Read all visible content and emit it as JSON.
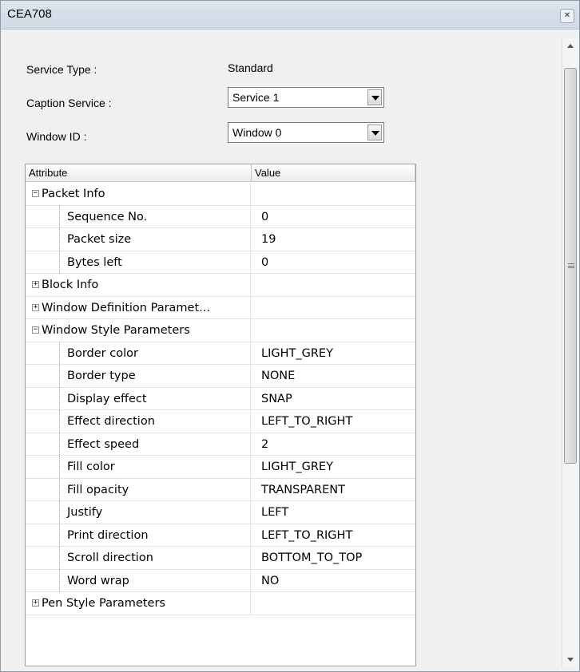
{
  "window": {
    "title": "CEA708",
    "close_icon": "close-icon"
  },
  "form": {
    "service_type_label": "Service Type :",
    "service_type_value": "Standard",
    "caption_service_label": "Caption Service :",
    "caption_service_value": "Service 1",
    "window_id_label": "Window ID :",
    "window_id_value": "Window 0"
  },
  "grid": {
    "headers": {
      "attribute": "Attribute",
      "value": "Value"
    },
    "rows": [
      {
        "label": "Packet Info",
        "value": "",
        "toggle": "−"
      },
      {
        "label": "Sequence No.",
        "value": "0"
      },
      {
        "label": "Packet size",
        "value": "19"
      },
      {
        "label": "Bytes left",
        "value": "0"
      },
      {
        "label": "Block Info",
        "value": "",
        "toggle": "+"
      },
      {
        "label": "Window Definition Paramet...",
        "value": "",
        "toggle": "+"
      },
      {
        "label": "Window Style Parameters",
        "value": "",
        "toggle": "−"
      },
      {
        "label": "Border color",
        "value": "LIGHT_GREY"
      },
      {
        "label": "Border type",
        "value": "NONE"
      },
      {
        "label": "Display effect",
        "value": "SNAP"
      },
      {
        "label": "Effect direction",
        "value": "LEFT_TO_RIGHT"
      },
      {
        "label": "Effect speed",
        "value": "2"
      },
      {
        "label": "Fill color",
        "value": "LIGHT_GREY"
      },
      {
        "label": "Fill opacity",
        "value": "TRANSPARENT"
      },
      {
        "label": "Justify",
        "value": "LEFT"
      },
      {
        "label": "Print direction",
        "value": "LEFT_TO_RIGHT"
      },
      {
        "label": "Scroll direction",
        "value": "BOTTOM_TO_TOP"
      },
      {
        "label": "Word wrap",
        "value": "NO"
      },
      {
        "label": "Pen Style Parameters",
        "value": "",
        "toggle": "+"
      }
    ]
  }
}
